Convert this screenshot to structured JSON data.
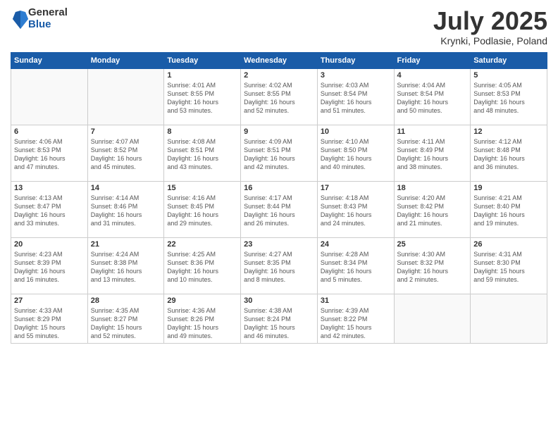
{
  "logo": {
    "general": "General",
    "blue": "Blue"
  },
  "title": "July 2025",
  "subtitle": "Krynki, Podlasie, Poland",
  "weekdays": [
    "Sunday",
    "Monday",
    "Tuesday",
    "Wednesday",
    "Thursday",
    "Friday",
    "Saturday"
  ],
  "weeks": [
    [
      {
        "day": "",
        "info": ""
      },
      {
        "day": "",
        "info": ""
      },
      {
        "day": "1",
        "info": "Sunrise: 4:01 AM\nSunset: 8:55 PM\nDaylight: 16 hours\nand 53 minutes."
      },
      {
        "day": "2",
        "info": "Sunrise: 4:02 AM\nSunset: 8:55 PM\nDaylight: 16 hours\nand 52 minutes."
      },
      {
        "day": "3",
        "info": "Sunrise: 4:03 AM\nSunset: 8:54 PM\nDaylight: 16 hours\nand 51 minutes."
      },
      {
        "day": "4",
        "info": "Sunrise: 4:04 AM\nSunset: 8:54 PM\nDaylight: 16 hours\nand 50 minutes."
      },
      {
        "day": "5",
        "info": "Sunrise: 4:05 AM\nSunset: 8:53 PM\nDaylight: 16 hours\nand 48 minutes."
      }
    ],
    [
      {
        "day": "6",
        "info": "Sunrise: 4:06 AM\nSunset: 8:53 PM\nDaylight: 16 hours\nand 47 minutes."
      },
      {
        "day": "7",
        "info": "Sunrise: 4:07 AM\nSunset: 8:52 PM\nDaylight: 16 hours\nand 45 minutes."
      },
      {
        "day": "8",
        "info": "Sunrise: 4:08 AM\nSunset: 8:51 PM\nDaylight: 16 hours\nand 43 minutes."
      },
      {
        "day": "9",
        "info": "Sunrise: 4:09 AM\nSunset: 8:51 PM\nDaylight: 16 hours\nand 42 minutes."
      },
      {
        "day": "10",
        "info": "Sunrise: 4:10 AM\nSunset: 8:50 PM\nDaylight: 16 hours\nand 40 minutes."
      },
      {
        "day": "11",
        "info": "Sunrise: 4:11 AM\nSunset: 8:49 PM\nDaylight: 16 hours\nand 38 minutes."
      },
      {
        "day": "12",
        "info": "Sunrise: 4:12 AM\nSunset: 8:48 PM\nDaylight: 16 hours\nand 36 minutes."
      }
    ],
    [
      {
        "day": "13",
        "info": "Sunrise: 4:13 AM\nSunset: 8:47 PM\nDaylight: 16 hours\nand 33 minutes."
      },
      {
        "day": "14",
        "info": "Sunrise: 4:14 AM\nSunset: 8:46 PM\nDaylight: 16 hours\nand 31 minutes."
      },
      {
        "day": "15",
        "info": "Sunrise: 4:16 AM\nSunset: 8:45 PM\nDaylight: 16 hours\nand 29 minutes."
      },
      {
        "day": "16",
        "info": "Sunrise: 4:17 AM\nSunset: 8:44 PM\nDaylight: 16 hours\nand 26 minutes."
      },
      {
        "day": "17",
        "info": "Sunrise: 4:18 AM\nSunset: 8:43 PM\nDaylight: 16 hours\nand 24 minutes."
      },
      {
        "day": "18",
        "info": "Sunrise: 4:20 AM\nSunset: 8:42 PM\nDaylight: 16 hours\nand 21 minutes."
      },
      {
        "day": "19",
        "info": "Sunrise: 4:21 AM\nSunset: 8:40 PM\nDaylight: 16 hours\nand 19 minutes."
      }
    ],
    [
      {
        "day": "20",
        "info": "Sunrise: 4:23 AM\nSunset: 8:39 PM\nDaylight: 16 hours\nand 16 minutes."
      },
      {
        "day": "21",
        "info": "Sunrise: 4:24 AM\nSunset: 8:38 PM\nDaylight: 16 hours\nand 13 minutes."
      },
      {
        "day": "22",
        "info": "Sunrise: 4:25 AM\nSunset: 8:36 PM\nDaylight: 16 hours\nand 10 minutes."
      },
      {
        "day": "23",
        "info": "Sunrise: 4:27 AM\nSunset: 8:35 PM\nDaylight: 16 hours\nand 8 minutes."
      },
      {
        "day": "24",
        "info": "Sunrise: 4:28 AM\nSunset: 8:34 PM\nDaylight: 16 hours\nand 5 minutes."
      },
      {
        "day": "25",
        "info": "Sunrise: 4:30 AM\nSunset: 8:32 PM\nDaylight: 16 hours\nand 2 minutes."
      },
      {
        "day": "26",
        "info": "Sunrise: 4:31 AM\nSunset: 8:30 PM\nDaylight: 15 hours\nand 59 minutes."
      }
    ],
    [
      {
        "day": "27",
        "info": "Sunrise: 4:33 AM\nSunset: 8:29 PM\nDaylight: 15 hours\nand 55 minutes."
      },
      {
        "day": "28",
        "info": "Sunrise: 4:35 AM\nSunset: 8:27 PM\nDaylight: 15 hours\nand 52 minutes."
      },
      {
        "day": "29",
        "info": "Sunrise: 4:36 AM\nSunset: 8:26 PM\nDaylight: 15 hours\nand 49 minutes."
      },
      {
        "day": "30",
        "info": "Sunrise: 4:38 AM\nSunset: 8:24 PM\nDaylight: 15 hours\nand 46 minutes."
      },
      {
        "day": "31",
        "info": "Sunrise: 4:39 AM\nSunset: 8:22 PM\nDaylight: 15 hours\nand 42 minutes."
      },
      {
        "day": "",
        "info": ""
      },
      {
        "day": "",
        "info": ""
      }
    ]
  ]
}
